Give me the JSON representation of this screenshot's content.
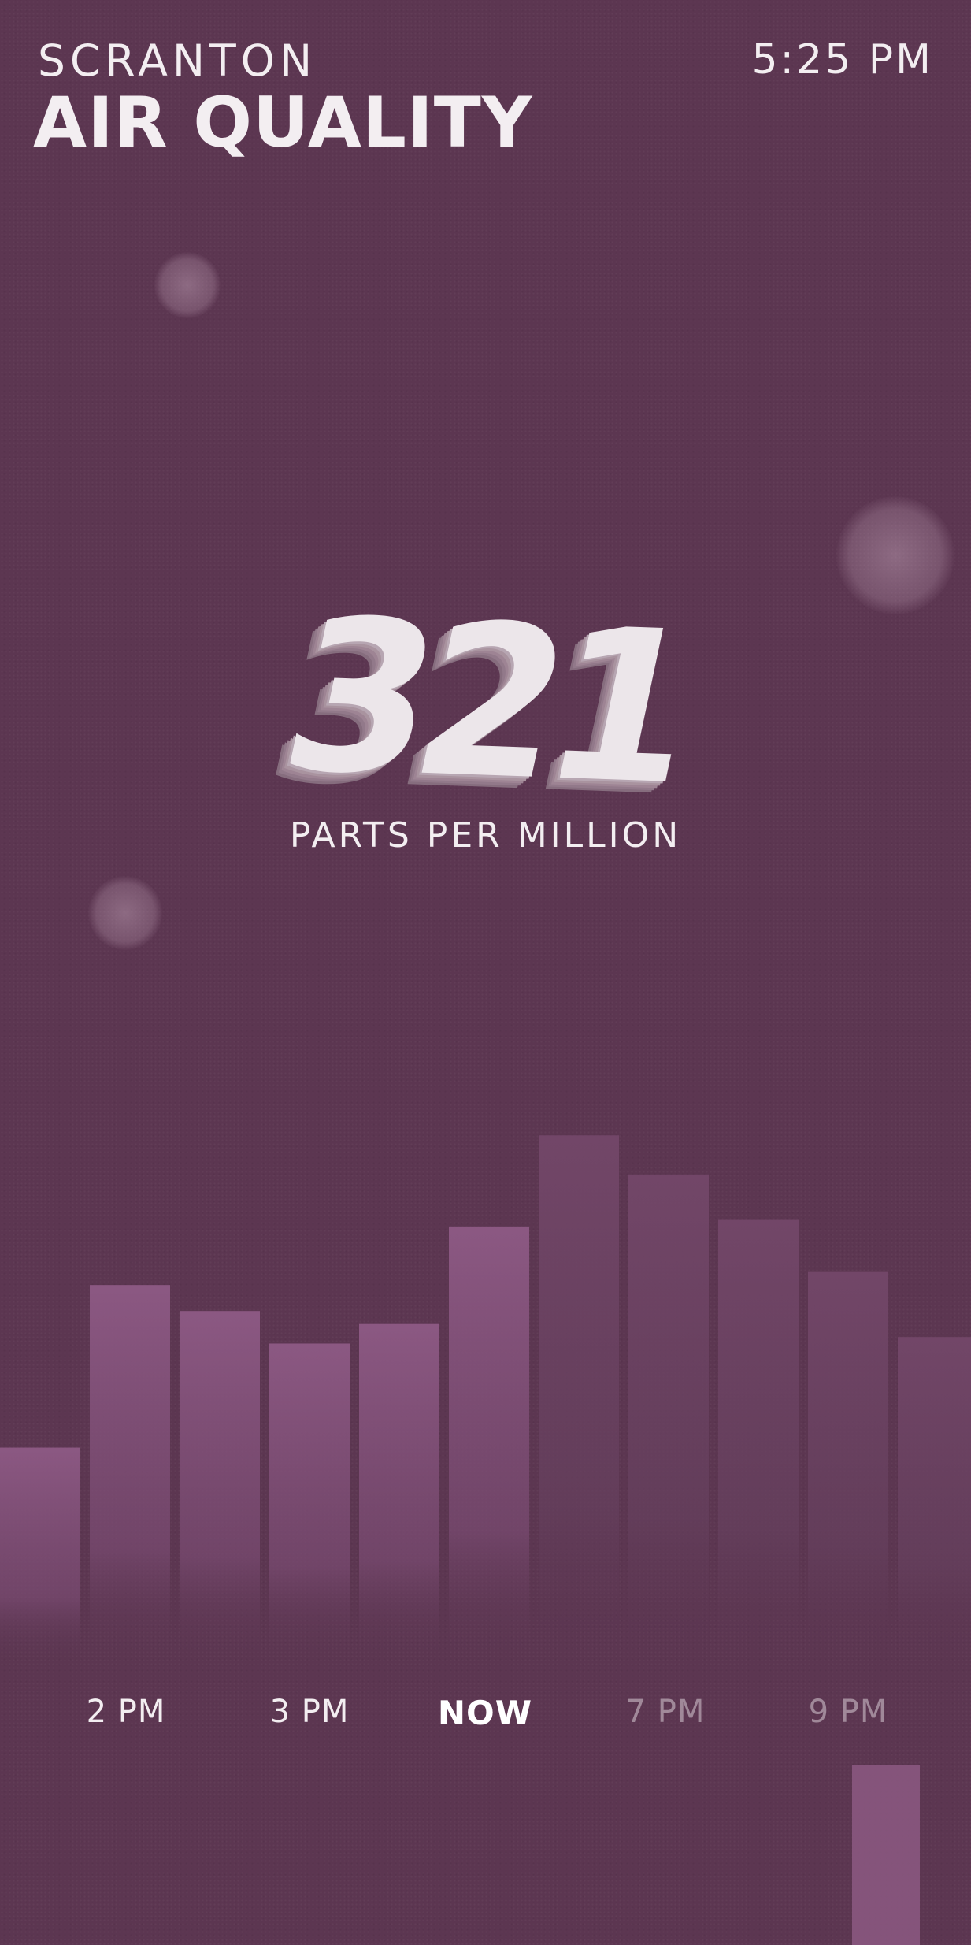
{
  "header": {
    "city": "SCRANTON",
    "title": "AIR QUALITY",
    "time": "5:25 PM"
  },
  "reading": {
    "value": "321",
    "unit": "PARTS PER MILLION"
  },
  "timeline": [
    {
      "label": "2 PM",
      "state": "past"
    },
    {
      "label": "3 PM",
      "state": "past"
    },
    {
      "label": "NOW",
      "state": "current"
    },
    {
      "label": "7 PM",
      "state": "future"
    },
    {
      "label": "9 PM",
      "state": "future"
    }
  ],
  "colors": {
    "background": "#5c3651",
    "bar_past": "#8a5880",
    "bar_future": "#6f4466",
    "text": "#f3eef1"
  },
  "chart_data": {
    "type": "bar",
    "title": "",
    "xlabel": "",
    "ylabel": "",
    "values": [
      165,
      290,
      270,
      245,
      260,
      335,
      405,
      375,
      340,
      300,
      250
    ],
    "states": [
      "past",
      "past",
      "past",
      "past",
      "past",
      "current",
      "future",
      "future",
      "future",
      "future",
      "future"
    ],
    "ylim": [
      0,
      430
    ],
    "grid": false
  }
}
